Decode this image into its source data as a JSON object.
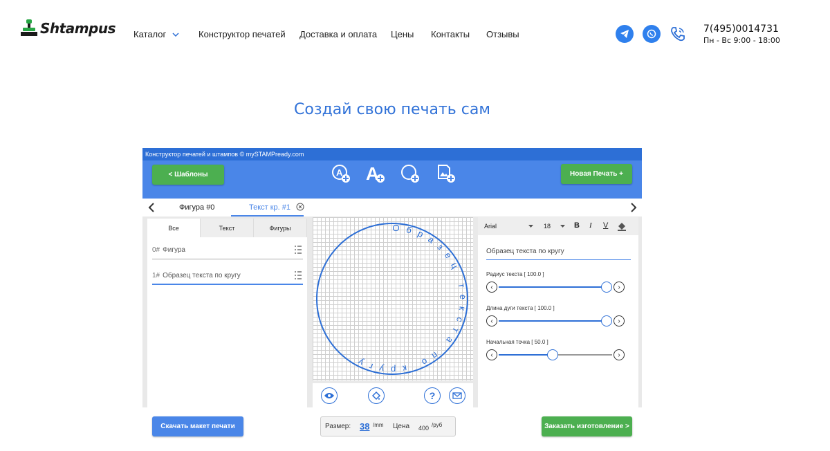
{
  "header": {
    "logo_text": "Shtampus",
    "nav": [
      "Каталог",
      "Конструктор печатей",
      "Доставка и оплата",
      "Цены",
      "Контакты",
      "Отзывы"
    ],
    "phone": "7(495)0014731",
    "hours": "Пн - Вс 9:00 - 18:00",
    "icons": [
      "telegram-icon",
      "whatsapp-icon",
      "phone-icon"
    ]
  },
  "page_title": "Создай свою печать сам",
  "app": {
    "title": "Конструктор печатей и штампов © mySTAMPready.com",
    "templates_button": "<   Шаблоны",
    "new_stamp_button": "Новая Печать +",
    "tabs": [
      "Фигура #0",
      "Текст кр. #1"
    ],
    "left_tabs": [
      "Все",
      "Текст",
      "Фигуры"
    ],
    "layers": [
      {
        "index": "0#",
        "label": "Фигура"
      },
      {
        "index": "1#",
        "label": "Образец текста по кругу"
      }
    ],
    "stamp_text": "Образец текста по кругу",
    "font": "Arial",
    "font_size": "18",
    "format": [
      "B",
      "I",
      "V"
    ],
    "text_input": "Образец текста по кругу",
    "sliders": [
      {
        "label": "Радиус текста [ 100.0 ]",
        "value": 1.0
      },
      {
        "label": "Длина дуги текста [ 100.0 ]",
        "value": 1.0
      },
      {
        "label": "Начальная точка [ 50.0 ]",
        "value": 0.5
      }
    ],
    "download_button": "Скачать макет печати",
    "size_label": "Размер:",
    "size_value": "38",
    "size_unit": "/mm",
    "price_label": "Цена",
    "price_value": "400",
    "price_unit": "/руб",
    "order_button": "Заказать изготовление >"
  },
  "colors": {
    "accent": "#4a86e8",
    "green": "#4caf50",
    "title": "#3172d8"
  }
}
